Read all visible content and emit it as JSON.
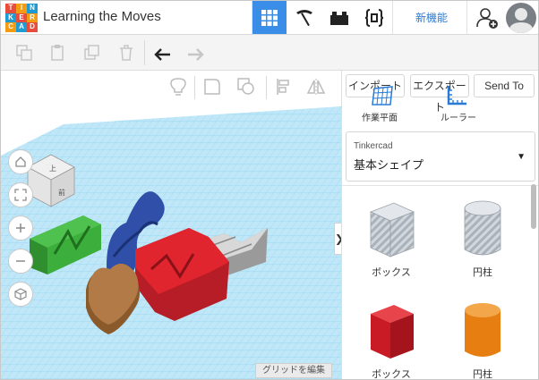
{
  "app": {
    "title": "Learning the Moves",
    "logo_letters": [
      "T",
      "I",
      "N",
      "K",
      "E",
      "R",
      "C",
      "A",
      "D"
    ],
    "new_features_label": "新機能"
  },
  "icons": {
    "grid": "grid-view-icon",
    "build": "pickaxe-icon",
    "bricks": "bricks-icon",
    "code": "code-blocks-icon",
    "user": "add-user-icon",
    "copy": "copy-icon",
    "paste": "paste-icon",
    "duplicate": "duplicate-icon",
    "delete": "delete-icon",
    "undo": "undo-icon",
    "redo": "redo-icon",
    "note": "light-bulb-icon",
    "group": "group-icon",
    "hole": "hole-icon",
    "align": "align-icon",
    "mirror": "mirror-icon"
  },
  "panel": {
    "import_label": "インポート",
    "export_label": "エクスポート",
    "send_to_label": "Send To",
    "workplane_label": "作業平面",
    "ruler_label": "ルーラー",
    "library_small": "Tinkercad",
    "library_name": "基本シェイプ",
    "shapes": [
      {
        "label": "ボックス",
        "icon": "striped-box-icon"
      },
      {
        "label": "円柱",
        "icon": "striped-cylinder-icon"
      },
      {
        "label": "ボックス",
        "icon": "red-box-icon"
      },
      {
        "label": "円柱",
        "icon": "orange-cylinder-icon"
      }
    ]
  },
  "viewport": {
    "view_cube_front": "前",
    "view_cube_top": "上",
    "edit_grid_label": "グリッドを編集",
    "collapse_glyph": "❯"
  },
  "colors": {
    "accent": "#3b8ee8",
    "grid": "#a9dcf2",
    "green": "#3cae3b",
    "blue": "#2f4fa8",
    "gray": "#d8d8d8",
    "red": "#e0252f",
    "brown": "#b27a47"
  }
}
